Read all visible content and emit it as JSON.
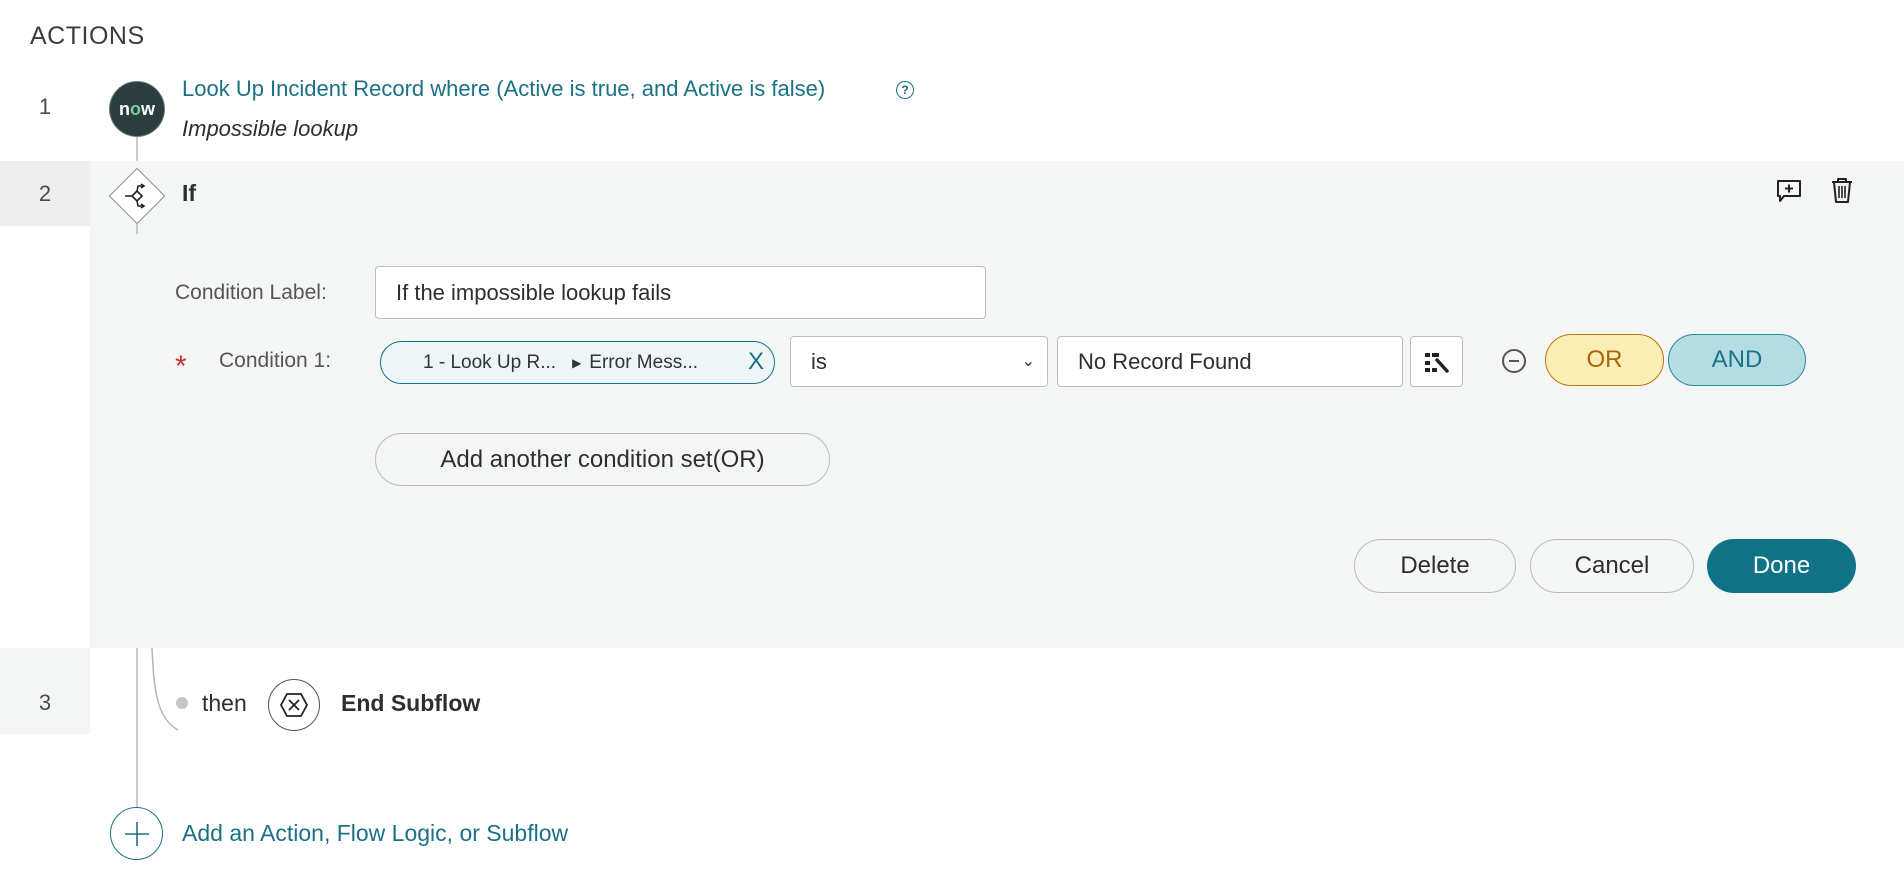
{
  "section_title": "ACTIONS",
  "steps": [
    {
      "number": "1",
      "icon": "servicenow-now-icon",
      "icon_text_pre": "n",
      "icon_text_o": "o",
      "icon_text_post": "w",
      "title": "Look Up Incident Record where (Active is true, and Active is false)",
      "help_icon": "?",
      "annotation": "Impossible lookup"
    },
    {
      "number": "2",
      "icon": "if-branch-icon",
      "title": "If",
      "toolbar": {
        "add_comment": "add-comment-icon",
        "delete": "trash-icon"
      },
      "form": {
        "condition_label_label": "Condition Label:",
        "condition_label_value": "If the impossible lookup fails",
        "required_marker": "*",
        "conditions": [
          {
            "label": "Condition 1:",
            "pill_step": "1 - Look Up R...",
            "pill_separator": "▶",
            "pill_field": "Error Mess...",
            "pill_remove": "X",
            "operator": "is",
            "value": "No Record Found",
            "or_label": "OR",
            "and_label": "AND"
          }
        ],
        "add_condition_set_label": "Add another condition set(OR)",
        "delete_label": "Delete",
        "cancel_label": "Cancel",
        "done_label": "Done"
      }
    },
    {
      "number": "3",
      "connector": "then",
      "icon": "end-subflow-icon",
      "title": "End Subflow"
    }
  ],
  "add_action_label": "Add an Action, Flow Logic, or Subflow",
  "colors": {
    "link": "#1a7185",
    "primary_button": "#0f7287",
    "or_bg": "#fbeeb4",
    "and_bg": "#b3dde3",
    "required": "#c8302e"
  }
}
